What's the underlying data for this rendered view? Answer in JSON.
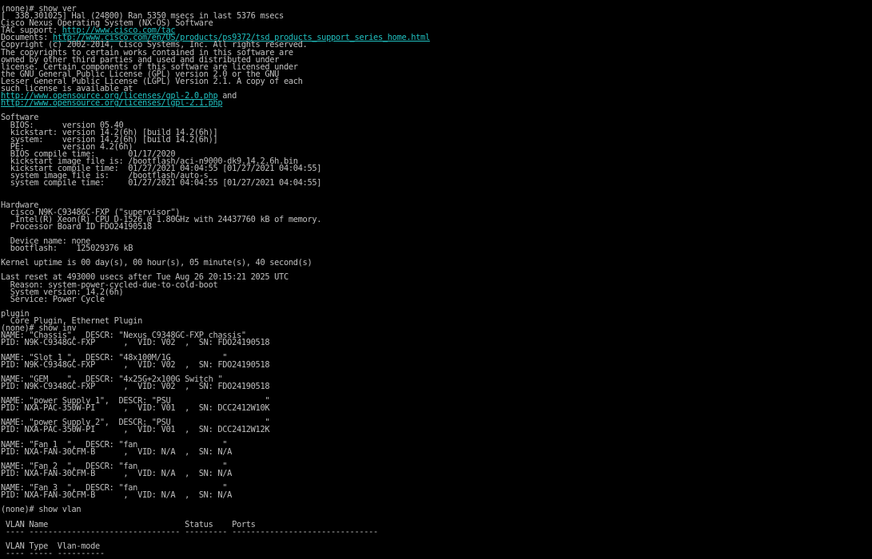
{
  "colors": {
    "background": "#000000",
    "text": "#c0c0c0",
    "link": "#20c0c0"
  },
  "terminal": {
    "lines": [
      [
        {
          "t": "(none)# show ver"
        }
      ],
      [
        {
          "t": "[  338.301025] Hal (24800) Ran 5350 msecs in last 5376 msecs"
        }
      ],
      [
        {
          "t": "Cisco Nexus Operating System (NX-OS) Software"
        }
      ],
      [
        {
          "t": "TAC support: "
        },
        {
          "t": "http://www.cisco.com/tac",
          "link": true
        }
      ],
      [
        {
          "t": "Documents: "
        },
        {
          "t": "http://www.cisco.com/en/US/products/ps9372/tsd_products_support_series_home.html",
          "link": true
        }
      ],
      [
        {
          "t": "Copyright (c) 2002-2014, Cisco Systems, Inc. All rights reserved."
        }
      ],
      [
        {
          "t": "The copyrights to certain works contained in this software are"
        }
      ],
      [
        {
          "t": "owned by other third parties and used and distributed under"
        }
      ],
      [
        {
          "t": "license. Certain components of this software are licensed under"
        }
      ],
      [
        {
          "t": "the GNU General Public License (GPL) version 2.0 or the GNU"
        }
      ],
      [
        {
          "t": "Lesser General Public License (LGPL) Version 2.1. A copy of each"
        }
      ],
      [
        {
          "t": "such license is available at"
        }
      ],
      [
        {
          "t": "http://www.opensource.org/licenses/gpl-2.0.php",
          "link": true
        },
        {
          "t": " and"
        }
      ],
      [
        {
          "t": "http://www.opensource.org/licenses/lgpl-2.1.php",
          "link": true
        }
      ],
      [
        {
          "t": ""
        }
      ],
      [
        {
          "t": "Software"
        }
      ],
      [
        {
          "t": "  BIOS:      version 05.40"
        }
      ],
      [
        {
          "t": "  kickstart: version 14.2(6h) [build 14.2(6h)]"
        }
      ],
      [
        {
          "t": "  system:    version 14.2(6h) [build 14.2(6h)]"
        }
      ],
      [
        {
          "t": "  PE:        version 4.2(6h)"
        }
      ],
      [
        {
          "t": "  BIOS compile time:       01/17/2020"
        }
      ],
      [
        {
          "t": "  kickstart image file is: /bootflash/aci-n9000-dk9.14.2.6h.bin"
        }
      ],
      [
        {
          "t": "  kickstart compile time:  01/27/2021 04:04:55 [01/27/2021 04:04:55]"
        }
      ],
      [
        {
          "t": "  system image file is:    /bootflash/auto-s"
        }
      ],
      [
        {
          "t": "  system compile time:     01/27/2021 04:04:55 [01/27/2021 04:04:55]"
        }
      ],
      [
        {
          "t": ""
        }
      ],
      [
        {
          "t": ""
        }
      ],
      [
        {
          "t": "Hardware"
        }
      ],
      [
        {
          "t": "  cisco N9K-C9348GC-FXP (\"supervisor\")"
        }
      ],
      [
        {
          "t": "   Intel(R) Xeon(R) CPU D-1526 @ 1.80GHz with 24437760 kB of memory."
        }
      ],
      [
        {
          "t": "  Processor Board ID FDO24190518"
        }
      ],
      [
        {
          "t": ""
        }
      ],
      [
        {
          "t": "  Device name: none"
        }
      ],
      [
        {
          "t": "  bootflash:    125029376 kB"
        }
      ],
      [
        {
          "t": ""
        }
      ],
      [
        {
          "t": "Kernel uptime is 00 day(s), 00 hour(s), 05 minute(s), 40 second(s)"
        }
      ],
      [
        {
          "t": ""
        }
      ],
      [
        {
          "t": "Last reset at 493000 usecs after Tue Aug 26 20:15:21 2025 UTC"
        }
      ],
      [
        {
          "t": "  Reason: system-power-cycled-due-to-cold-boot"
        }
      ],
      [
        {
          "t": "  System version: 14.2(6h)"
        }
      ],
      [
        {
          "t": "  Service: Power Cycle"
        }
      ],
      [
        {
          "t": ""
        }
      ],
      [
        {
          "t": "plugin"
        }
      ],
      [
        {
          "t": "  Core Plugin, Ethernet Plugin"
        }
      ],
      [
        {
          "t": "(none)# show inv"
        }
      ],
      [
        {
          "t": "NAME: \"Chassis\",  DESCR: \"Nexus C9348GC-FXP chassis\""
        }
      ],
      [
        {
          "t": "PID: N9K-C9348GC-FXP      ,  VID: V02  ,  SN: FDO24190518"
        }
      ],
      [
        {
          "t": ""
        }
      ],
      [
        {
          "t": "NAME: \"Slot 1 \",  DESCR: \"48x100M/1G           \""
        }
      ],
      [
        {
          "t": "PID: N9K-C9348GC-FXP      ,  VID: V02  ,  SN: FDO24190518"
        }
      ],
      [
        {
          "t": ""
        }
      ],
      [
        {
          "t": "NAME: \"GEM    \",  DESCR: \"4x25G+2x100G Switch \""
        }
      ],
      [
        {
          "t": "PID: N9K-C9348GC-FXP      ,  VID: V02  ,  SN: FDO24190518"
        }
      ],
      [
        {
          "t": ""
        }
      ],
      [
        {
          "t": "NAME: \"power Supply 1\",  DESCR: \"PSU                    \""
        }
      ],
      [
        {
          "t": "PID: NXA-PAC-350W-PI      ,  VID: V01  ,  SN: DCC2412W10K"
        }
      ],
      [
        {
          "t": ""
        }
      ],
      [
        {
          "t": "NAME: \"power Supply 2\",  DESCR: \"PSU                    \""
        }
      ],
      [
        {
          "t": "PID: NXA-PAC-350W-PI      ,  VID: V01  ,  SN: DCC2412W12K"
        }
      ],
      [
        {
          "t": ""
        }
      ],
      [
        {
          "t": "NAME: \"Fan 1  \",  DESCR: \"fan                  \""
        }
      ],
      [
        {
          "t": "PID: NXA-FAN-30CFM-B      ,  VID: N/A  ,  SN: N/A"
        }
      ],
      [
        {
          "t": ""
        }
      ],
      [
        {
          "t": "NAME: \"Fan 2  \",  DESCR: \"fan                  \""
        }
      ],
      [
        {
          "t": "PID: NXA-FAN-30CFM-B      ,  VID: N/A  ,  SN: N/A"
        }
      ],
      [
        {
          "t": ""
        }
      ],
      [
        {
          "t": "NAME: \"Fan 3  \",  DESCR: \"fan                  \""
        }
      ],
      [
        {
          "t": "PID: NXA-FAN-30CFM-B      ,  VID: N/A  ,  SN: N/A"
        }
      ],
      [
        {
          "t": ""
        }
      ],
      [
        {
          "t": "(none)# show vlan"
        }
      ],
      [
        {
          "t": ""
        }
      ],
      [
        {
          "t": " VLAN Name                             Status    Ports"
        }
      ],
      [
        {
          "t": " ---- -------------------------------- --------- -------------------------------"
        }
      ],
      [
        {
          "t": ""
        }
      ],
      [
        {
          "t": " VLAN Type  Vlan-mode"
        }
      ],
      [
        {
          "t": " ---- ----- ----------"
        }
      ],
      [
        {
          "t": ""
        }
      ]
    ],
    "prompt": "(none)# ",
    "input_value": ""
  }
}
